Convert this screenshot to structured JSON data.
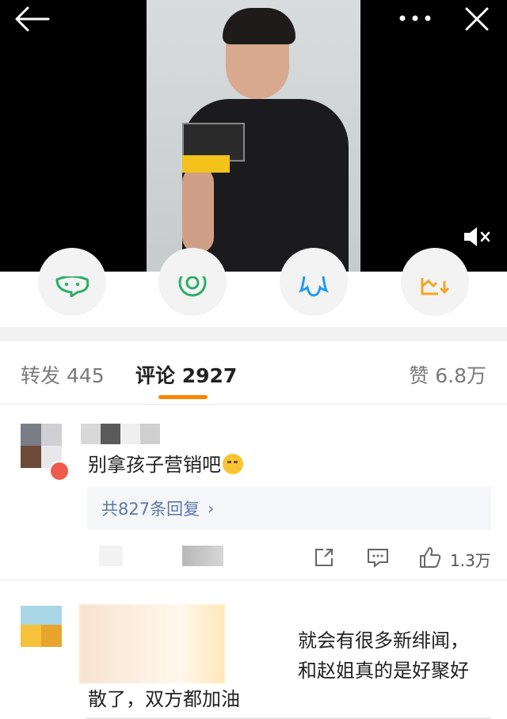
{
  "video": {
    "back_icon": "arrow-left-icon",
    "more_icon": "more-dots-icon",
    "close_icon": "close-icon",
    "mute_icon": "speaker-muted-icon"
  },
  "actions": [
    {
      "icon": "wechat-icon",
      "color": "#2aae67"
    },
    {
      "icon": "moments-icon",
      "color": "#2aae67"
    },
    {
      "icon": "qq-icon",
      "color": "#1e9bf0"
    },
    {
      "icon": "save-image-icon",
      "color": "#f5a623"
    }
  ],
  "tabs": {
    "repost": "转发 445",
    "comment": "评论 2927",
    "like": "赞 6.8万",
    "accent": "#ff8200"
  },
  "comments": [
    {
      "text": "别拿孩子营销吧",
      "replies": "共827条回复",
      "like_count": "1.3万"
    },
    {
      "line1": "就会有很多新绯闻，",
      "line2": "和赵姐真的是好聚好",
      "line3": "散了，双方都加油"
    }
  ]
}
